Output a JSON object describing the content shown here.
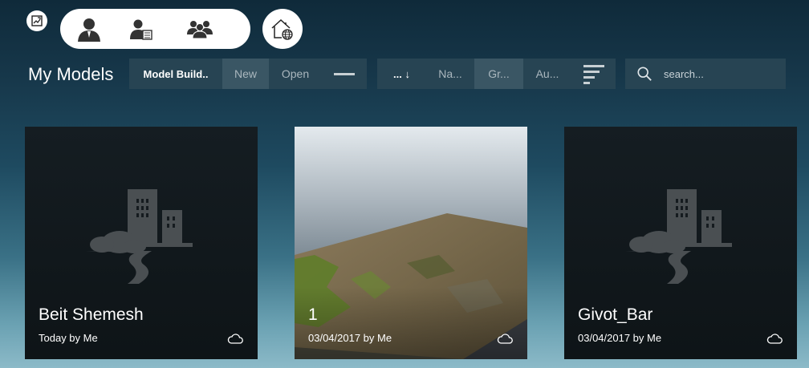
{
  "header": {
    "toggle_icon": "image-swap-icon",
    "user_icons": [
      "single-user-icon",
      "user-document-icon",
      "user-group-icon"
    ],
    "home_icon": "home-globe-icon"
  },
  "page": {
    "title": "My Models"
  },
  "toolbar": {
    "category": "Model Build..",
    "new_label": "New",
    "open_label": "Open",
    "sort_label": "... ↓",
    "sort_options": [
      "Na...",
      "Gr...",
      "Au..."
    ],
    "search_placeholder": "search..."
  },
  "models": [
    {
      "name": "Beit Shemesh",
      "meta": "Today by Me",
      "thumbnail": "placeholder",
      "sync_icon": "cloud-icon"
    },
    {
      "name": "1",
      "meta": "03/04/2017 by Me",
      "thumbnail": "terrain",
      "sync_icon": "cloud-icon"
    },
    {
      "name": "Givot_Bar",
      "meta": "03/04/2017 by Me",
      "thumbnail": "placeholder",
      "sync_icon": "cloud-icon"
    }
  ],
  "colors": {
    "toolbar_bg": "#274453",
    "highlight_bg": "#3a5664",
    "card_bg": "#11181c"
  }
}
